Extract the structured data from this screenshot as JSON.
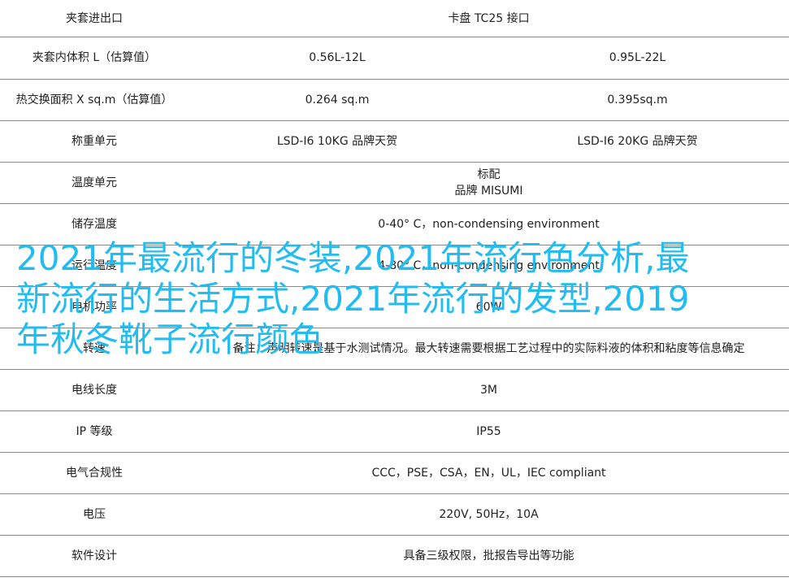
{
  "rows": [
    {
      "label": "夹套进出口",
      "a": "",
      "b": "",
      "span": "卡盘 TC25 接口"
    },
    {
      "label": "夹套内体积 L（估算值）",
      "a": "0.56L-12L",
      "b": "0.95L-22L"
    },
    {
      "label": "热交换面积 X sq.m（估算值）",
      "a": "0.264 sq.m",
      "b": "0.395sq.m"
    },
    {
      "label": "称重单元",
      "a": "LSD-I6 10KG 品牌天贺",
      "b": "LSD-I6 20KG 品牌天贺"
    },
    {
      "label": "温度单元",
      "span_lines": [
        "标配",
        "品牌 MISUMI"
      ]
    },
    {
      "label": "储存温度",
      "span": "0-40° C，non-condensing environment"
    },
    {
      "label": "运行温度",
      "span": "4-80° C，non-condensing environment"
    },
    {
      "label": "电机功率",
      "span": "60W"
    },
    {
      "label": "转速",
      "span": "备注：声明转速是基于水测试情况。最大转速需要根据工艺过程中的实际料液的体积和粘度等信息确定"
    },
    {
      "label": "电线长度",
      "span": "3M"
    },
    {
      "label": "IP 等级",
      "span": "IP55"
    },
    {
      "label": "电气合规性",
      "span": "CCC，PSE，CSA，EN，UL，IEC compliant"
    },
    {
      "label": "电压",
      "span": "220V, 50Hz，10A"
    },
    {
      "label": "软件设计",
      "span": "具备三级权限，批报告导出等功能"
    }
  ],
  "overlay": {
    "text": "2021年最流行的冬装,2021年流行色分析,最新流行的生活方式,2021年流行的发型,2019年秋冬靴子流行颜色",
    "color": "#22bcf0"
  }
}
